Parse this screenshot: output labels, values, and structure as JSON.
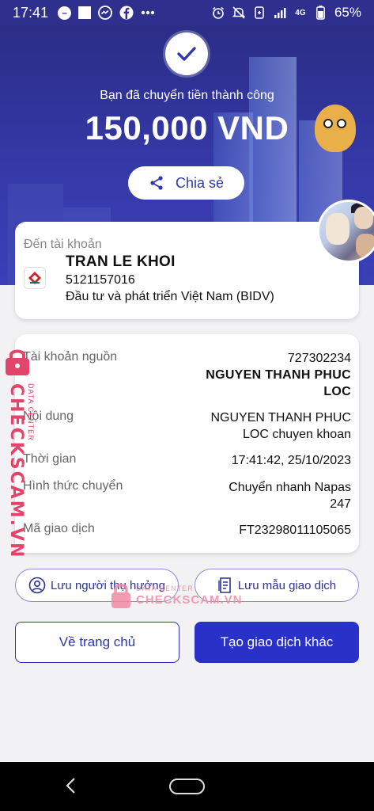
{
  "status_bar": {
    "time": "17:41",
    "network": "4G",
    "battery": "65%",
    "icons": [
      "dnd-icon",
      "square-icon",
      "messenger-icon",
      "facebook-icon",
      "more-dots-icon",
      "alarm-icon",
      "mute-icon",
      "data-saver-icon",
      "signal-icon",
      "battery-icon"
    ]
  },
  "hero": {
    "success_message": "Bạn đã chuyển tiền thành công",
    "amount": "150,000 VND",
    "share_label": "Chia sẻ"
  },
  "recipient": {
    "label": "Đến tài khoản",
    "name": "TRAN LE KHOI",
    "account_number": "5121157016",
    "bank": "Đầu tư và phát triển Việt Nam (BIDV)"
  },
  "details": {
    "source_label": "Tài khoản nguồn",
    "source_account": "727302234",
    "source_name_line1": "NGUYEN THANH PHUC",
    "source_name_line2": "LOC",
    "content_label": "Nội dung",
    "content_line1": "NGUYEN THANH PHUC",
    "content_line2": "LOC chuyen khoan",
    "time_label": "Thời gian",
    "time_value": "17:41:42, 25/10/2023",
    "method_label": "Hình thức chuyển",
    "method_line1": "Chuyển nhanh Napas",
    "method_line2": "247",
    "txn_label": "Mã giao dịch",
    "txn_value": "FT23298011105065"
  },
  "actions": {
    "save_beneficiary": "Lưu người thụ hưởng",
    "save_template": "Lưu mẫu giao dịch",
    "home": "Về trang chủ",
    "new_transaction": "Tạo giao dịch khác"
  },
  "watermark": {
    "side_text": "CHECKSCAM.VN",
    "side_sub": "DATA CENTER",
    "center_sub": "DATA CENTER",
    "center_text": "CHECKSCAM.VN"
  },
  "colors": {
    "primary": "#2a31c9",
    "hero": "#3539a8",
    "watermark": "#e2456b"
  }
}
